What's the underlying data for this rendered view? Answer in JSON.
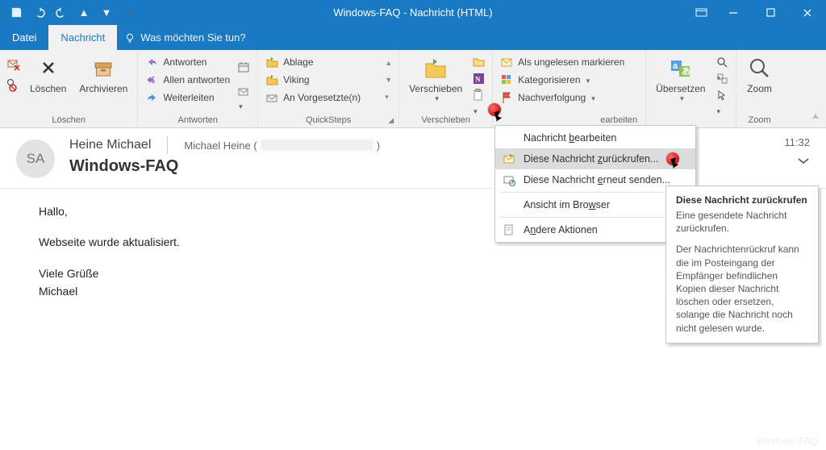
{
  "title": "Windows-FAQ  -  Nachricht (HTML)",
  "tabs": {
    "file": "Datei",
    "message": "Nachricht",
    "tellme": "Was möchten Sie tun?"
  },
  "ribbon": {
    "delete_group": "Löschen",
    "delete": "Löschen",
    "archive": "Archivieren",
    "respond_group": "Antworten",
    "reply": "Antworten",
    "reply_all": "Allen antworten",
    "forward": "Weiterleiten",
    "quicksteps_group": "QuickSteps",
    "qs1": "Ablage",
    "qs2": "Viking",
    "qs3": "An Vorgesetzte(n)",
    "move_group": "Verschieben",
    "move": "Verschieben",
    "tags_unread": "Als ungelesen markieren",
    "tags_categorize": "Kategorisieren",
    "tags_followup": "Nachverfolgung",
    "tags_group_visible": "earbeiten",
    "edit_translate": "Übersetzen",
    "zoom_group": "Zoom",
    "zoom": "Zoom"
  },
  "dropdown": {
    "edit_message": "Nachricht bearbeiten",
    "recall": "Diese Nachricht zurückrufen...",
    "resend": "Diese Nachricht erneut senden...",
    "view_browser": "Ansicht im Browser",
    "other": "Andere Aktionen"
  },
  "screentip": {
    "title": "Diese Nachricht zurückrufen",
    "p1": "Eine gesendete Nachricht zurückrufen.",
    "p2": "Der Nachrichtenrückruf kann die im Posteingang der Empfänger befindlichen Kopien dieser Nachricht löschen oder ersetzen, solange die Nachricht noch nicht gelesen wurde."
  },
  "header": {
    "initials": "SA",
    "sender": "Heine Michael",
    "recipients_prefix": "Michael Heine (",
    "recipients_suffix": ")",
    "subject": "Windows-FAQ",
    "time": "11:32"
  },
  "body": {
    "l1": "Hallo,",
    "l2": "Webseite wurde aktualisiert.",
    "l3": "Viele Grüße",
    "l4": "Michael"
  },
  "watermark": "Windows-FAQ"
}
